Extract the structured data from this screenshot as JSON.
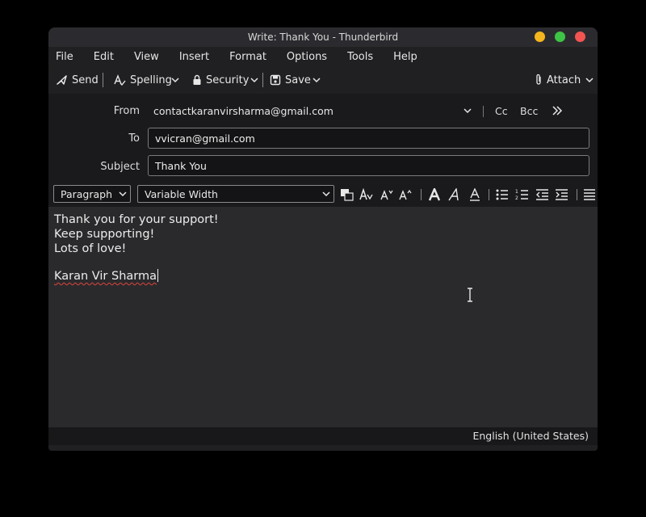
{
  "window": {
    "title": "Write: Thank You - Thunderbird"
  },
  "menu": [
    "File",
    "Edit",
    "View",
    "Insert",
    "Format",
    "Options",
    "Tools",
    "Help"
  ],
  "toolbar": {
    "send": "Send",
    "spelling": "Spelling",
    "security": "Security",
    "save": "Save",
    "attach": "Attach"
  },
  "headers": {
    "from_label": "From",
    "from_value": "contactkaranvirsharma@gmail.com",
    "cc": "Cc",
    "bcc": "Bcc",
    "to_label": "To",
    "to_value": "vvicran@gmail.com",
    "subject_label": "Subject",
    "subject_value": "Thank You"
  },
  "format": {
    "paragraph": "Paragraph",
    "font": "Variable Width"
  },
  "body": {
    "lines": [
      "Thank you for your support!",
      "Keep supporting!",
      "Lots of love!"
    ],
    "signature": "Karan Vir Sharma"
  },
  "status": {
    "language": "English (United States)"
  },
  "colors": {
    "min": "#f5b51e",
    "max": "#3ec444",
    "close": "#f25452",
    "spell_error": "#e0453a"
  },
  "icons": [
    "send-icon",
    "spelling-icon",
    "lock-icon",
    "save-icon",
    "paperclip-icon",
    "chevron-down-icon",
    "double-chevron-right-icon",
    "text-color-icon",
    "font-size-decrease-icon",
    "font-size-increase-icon",
    "bold-icon",
    "italic-icon",
    "underline-icon",
    "bullet-list-icon",
    "numbered-list-icon",
    "outdent-icon",
    "indent-icon",
    "align-icon",
    "text-cursor-icon"
  ]
}
